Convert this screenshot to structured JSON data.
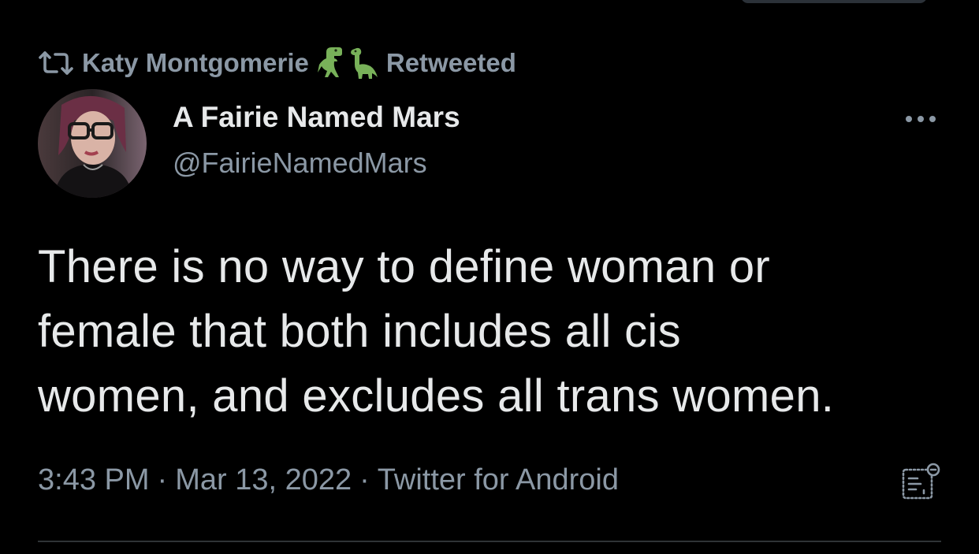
{
  "retweet_context": {
    "icon": "retweet-icon",
    "retweeter_name": "Katy Montgomerie",
    "emoji": [
      "🦖",
      "🦕"
    ],
    "label": "Retweeted"
  },
  "tweet": {
    "avatar": "profile-avatar",
    "display_name": "A Fairie Named Mars",
    "handle": "@FairieNamedMars",
    "text_lines": [
      "There is no way to define woman or",
      "female that both includes all cis",
      "women, and excludes all trans women."
    ],
    "time": "3:43 PM",
    "separator": "·",
    "date": "Mar 13, 2022",
    "source": "Twitter for Android",
    "more_icon": "more-options-icon",
    "analytics_icon": "view-analytics-icon"
  },
  "colors": {
    "background": "#000000",
    "primary_text": "#e7e9ea",
    "secondary_text": "#8b98a5",
    "divider": "#2f3336",
    "dino_green": "#78b159"
  }
}
